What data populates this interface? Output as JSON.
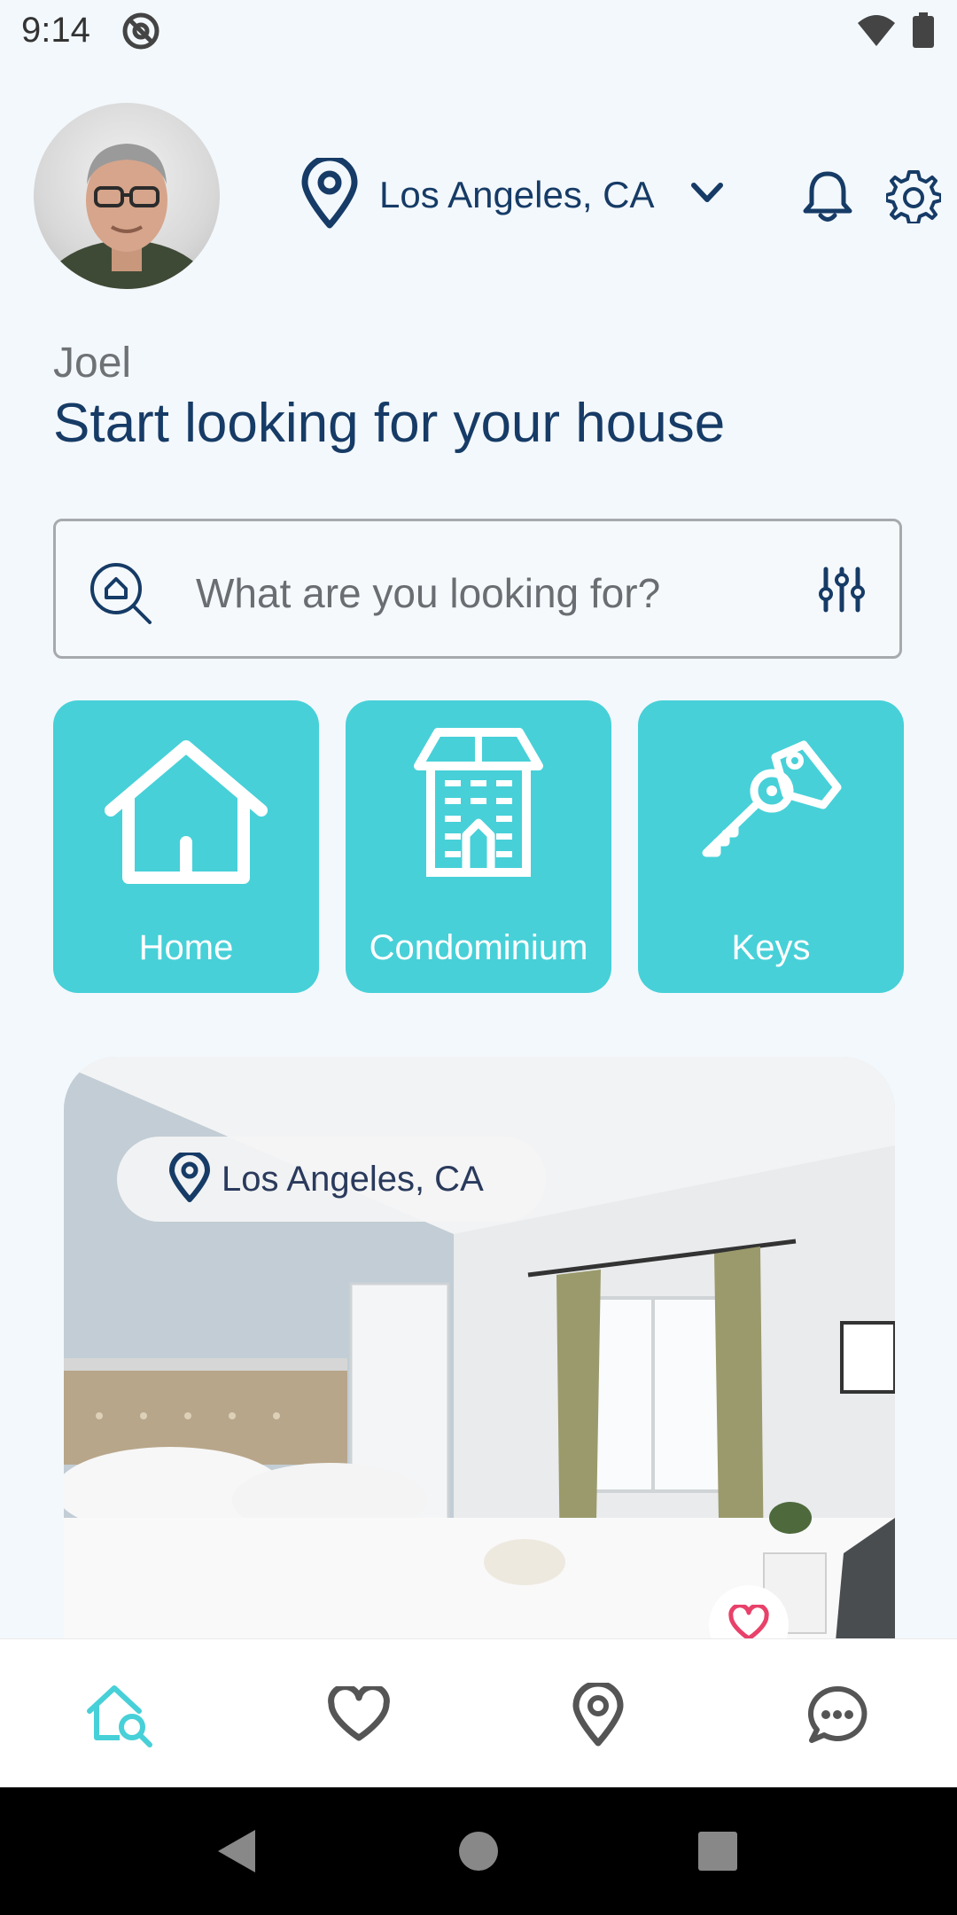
{
  "status": {
    "time": "9:14"
  },
  "header": {
    "location": "Los Angeles, CA"
  },
  "greeting": {
    "name": "Joel",
    "headline": "Start looking for your house"
  },
  "search": {
    "placeholder": "What are you looking for?"
  },
  "categories": [
    {
      "label": "Home",
      "icon": "house-icon"
    },
    {
      "label": "Condominium",
      "icon": "building-icon"
    },
    {
      "label": "Keys",
      "icon": "keys-icon"
    }
  ],
  "listing": {
    "location": "Los Angeles, CA",
    "favorited": false
  },
  "bottom_nav": [
    "home-search",
    "favorites",
    "map-pin",
    "messages"
  ],
  "colors": {
    "primary": "#163b66",
    "accent": "#47d0d8",
    "heart": "#e8416a",
    "background": "#f3f8fc"
  }
}
